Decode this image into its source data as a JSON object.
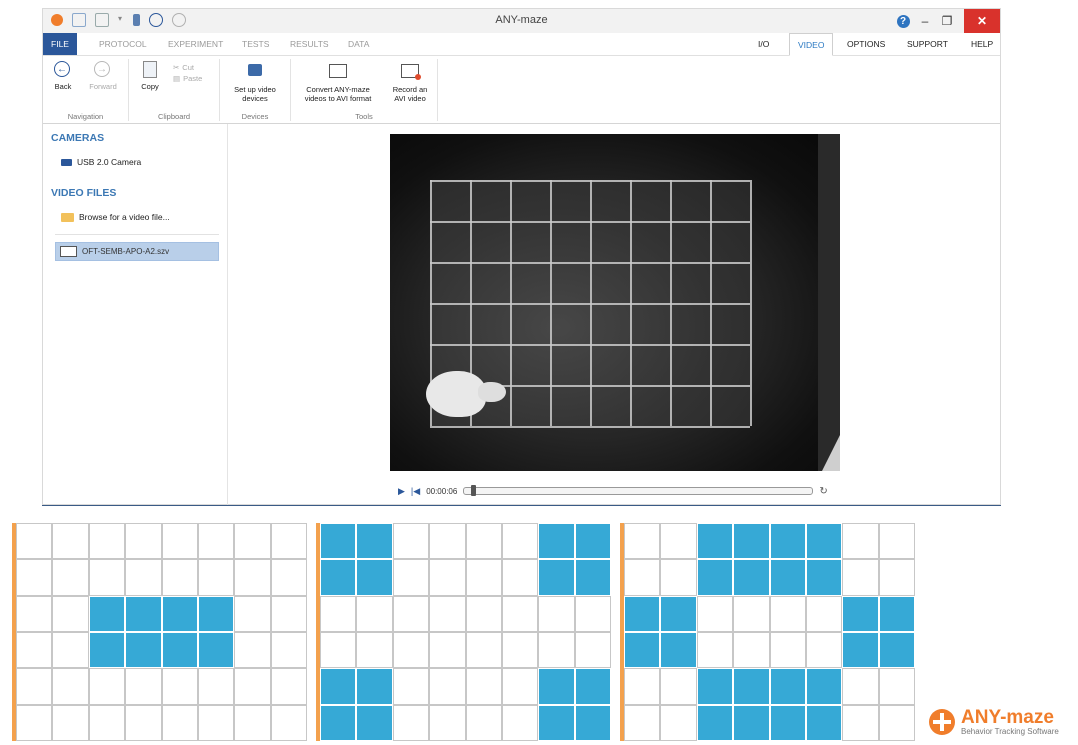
{
  "window": {
    "title": "ANY-maze"
  },
  "menu": {
    "file": "FILE",
    "left_tabs": [
      "PROTOCOL",
      "EXPERIMENT",
      "TESTS",
      "RESULTS",
      "DATA"
    ],
    "right_tabs": [
      "I/O",
      "VIDEO",
      "OPTIONS",
      "SUPPORT",
      "HELP"
    ],
    "active_tab": "VIDEO"
  },
  "ribbon": {
    "navigation": {
      "label": "Navigation",
      "back": "Back",
      "forward": "Forward"
    },
    "clipboard": {
      "label": "Clipboard",
      "copy": "Copy",
      "cut": "Cut",
      "paste": "Paste"
    },
    "devices": {
      "label": "Devices",
      "setup_line1": "Set up video",
      "setup_line2": "devices"
    },
    "tools": {
      "label": "Tools",
      "convert_line1": "Convert ANY-maze",
      "convert_line2": "videos to AVI format",
      "record_line1": "Record an",
      "record_line2": "AVI video"
    }
  },
  "sidebar": {
    "cameras_heading": "CAMERAS",
    "camera": "USB 2.0 Camera",
    "video_files_heading": "VIDEO FILES",
    "browse": "Browse for a video file...",
    "selected_file": "OFT-SEMB-APO-A2.szv"
  },
  "playback": {
    "time": "00:00:06",
    "position_fraction": 0.02
  },
  "zone_grids": {
    "cols": 8,
    "rows": 6,
    "accent_color": "#36a9d6",
    "border_color": "#f3a14d",
    "patterns": [
      [
        [
          2,
          2
        ],
        [
          2,
          3
        ],
        [
          2,
          4
        ],
        [
          2,
          5
        ],
        [
          3,
          2
        ],
        [
          3,
          3
        ],
        [
          3,
          4
        ],
        [
          3,
          5
        ]
      ],
      [
        [
          0,
          0
        ],
        [
          0,
          1
        ],
        [
          1,
          0
        ],
        [
          1,
          1
        ],
        [
          0,
          6
        ],
        [
          0,
          7
        ],
        [
          1,
          6
        ],
        [
          1,
          7
        ],
        [
          4,
          0
        ],
        [
          4,
          1
        ],
        [
          5,
          0
        ],
        [
          5,
          1
        ],
        [
          4,
          6
        ],
        [
          4,
          7
        ],
        [
          5,
          6
        ],
        [
          5,
          7
        ]
      ],
      [
        [
          0,
          2
        ],
        [
          0,
          3
        ],
        [
          0,
          4
        ],
        [
          0,
          5
        ],
        [
          1,
          2
        ],
        [
          1,
          3
        ],
        [
          1,
          4
        ],
        [
          1,
          5
        ],
        [
          2,
          0
        ],
        [
          2,
          1
        ],
        [
          3,
          0
        ],
        [
          3,
          1
        ],
        [
          2,
          6
        ],
        [
          2,
          7
        ],
        [
          3,
          6
        ],
        [
          3,
          7
        ],
        [
          4,
          2
        ],
        [
          4,
          3
        ],
        [
          4,
          4
        ],
        [
          4,
          5
        ],
        [
          5,
          2
        ],
        [
          5,
          3
        ],
        [
          5,
          4
        ],
        [
          5,
          5
        ]
      ]
    ]
  },
  "logo": {
    "name": "ANY-maze",
    "tagline": "Behavior Tracking Software"
  }
}
